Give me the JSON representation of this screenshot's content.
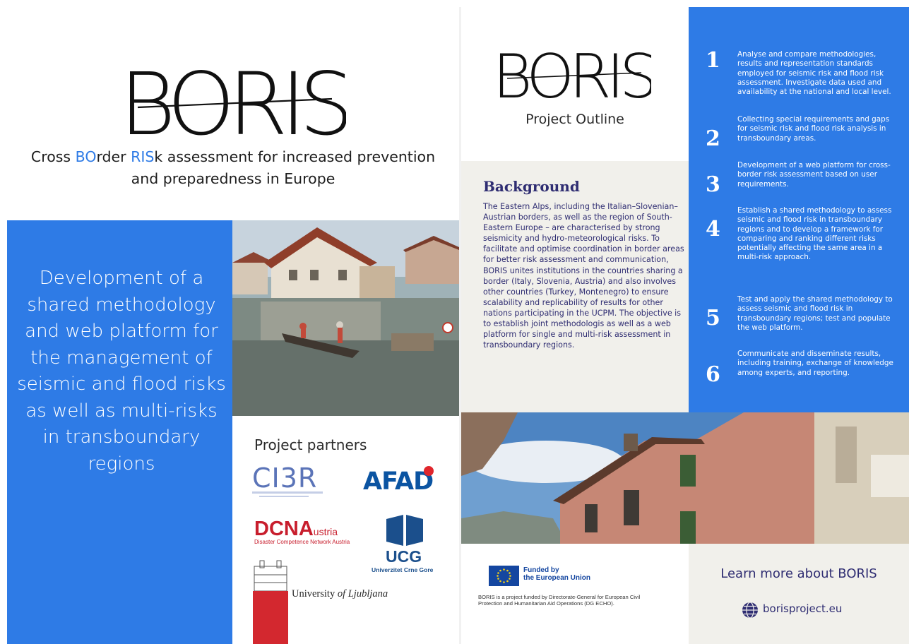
{
  "brand": {
    "logo": "BORIS",
    "subtitle_parts": [
      {
        "text": "Cross ",
        "hl": false
      },
      {
        "text": "BO",
        "hl": true
      },
      {
        "text": "rder ",
        "hl": false
      },
      {
        "text": "RIS",
        "hl": true
      },
      {
        "text": "k assessment for increased prevention and preparedness in Europe",
        "hl": false
      }
    ]
  },
  "left": {
    "blue_text": "Development of a shared methodology and web platform for the management of seismic and flood risks as well as multi-risks in transboundary regions",
    "partners_title": "Project partners",
    "partners": {
      "ci3r": "CI3R",
      "afad": "AFAD",
      "dcna_big": "DCNA",
      "dcna_small": "ustria",
      "dcna_sub": "Disaster Competence Network Austria",
      "ucg": "UCG",
      "ucg_sub": "Univerzitet Crne Gore",
      "ul_prefix": "University ",
      "ul_italic": "of Ljubljana"
    }
  },
  "right": {
    "outline_title": "Project Outline",
    "background_title": "Background",
    "background_text": "The Eastern Alps, including the Italian–Slovenian–Austrian borders, as well as the region of South-Eastern Europe – are characterised by strong seismicity and hydro-meteorological risks. To facilitate and optimise coordination in border areas for better risk assessment and communication, BORIS unites institutions in the countries sharing a border (Italy, Slovenia, Austria) and also involves other countries (Turkey, Montenegro) to ensure scalability and replicability of results for other nations participating in the UCPM. The objective is to establish joint methodologis as well as a web platform for single and multi-risk assessment in transboundary regions.",
    "steps": [
      {
        "num": "1",
        "text": "Analyse and compare methodologies, results and representation standards employed for seismic risk and flood risk assessment. Investigate data used and availability at the national and local level."
      },
      {
        "num": "2",
        "text": "Collecting special requirements and gaps for seismic risk and flood risk analysis in transboundary areas."
      },
      {
        "num": "3",
        "text": "Development of a web platform for cross-border risk assessment based on user requirements."
      },
      {
        "num": "4",
        "text": "Establish a shared methodology to assess seismic and flood risk in transboundary regions and to develop a framework for comparing and ranking different risks potentially affecting the same area in a multi-risk approach."
      },
      {
        "num": "5",
        "text": "Test and apply the shared methodology to assess seismic and flood risk in transboundary regions; test and populate the web platform."
      },
      {
        "num": "6",
        "text": "Communicate and disseminate results, including training, exchange of knowledge among experts, and reporting."
      }
    ],
    "eu_funded": "Funded by the European Union",
    "eu_funded_line1": "Funded by",
    "eu_funded_line2": "the European Union",
    "eu_text": "BORIS is a project funded by Directorate-General for European Civil Protection and Humanitarian Aid Operations (DG ECHO).",
    "learn_title": "Learn more about BORIS",
    "learn_url": "borisproject.eu"
  },
  "colors": {
    "accent_blue": "#2e7be6",
    "navy": "#2f2d72",
    "beige": "#f1f0eb"
  }
}
